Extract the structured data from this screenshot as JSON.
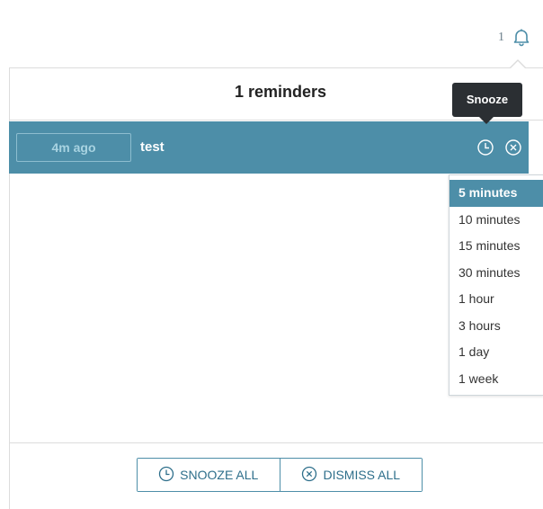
{
  "header": {
    "notification_count": "1",
    "bell_icon": "bell-icon"
  },
  "panel": {
    "title": "1 reminders"
  },
  "reminder": {
    "time_ago": "4m ago",
    "text": "test",
    "snooze_icon": "clock-icon",
    "dismiss_icon": "close-circle-icon"
  },
  "tooltip": {
    "label": "Snooze"
  },
  "snooze_menu": {
    "items": [
      {
        "label": "5 minutes",
        "active": true
      },
      {
        "label": "10 minutes",
        "active": false
      },
      {
        "label": "15 minutes",
        "active": false
      },
      {
        "label": "30 minutes",
        "active": false
      },
      {
        "label": "1 hour",
        "active": false
      },
      {
        "label": "3 hours",
        "active": false
      },
      {
        "label": "1 day",
        "active": false
      },
      {
        "label": "1 week",
        "active": false
      }
    ]
  },
  "footer": {
    "snooze_all_label": "SNOOZE ALL",
    "dismiss_all_label": "DISMISS ALL"
  },
  "colors": {
    "accent": "#4d8ea8",
    "tooltip_bg": "#2b2f33",
    "button_text": "#2e6f8b"
  }
}
